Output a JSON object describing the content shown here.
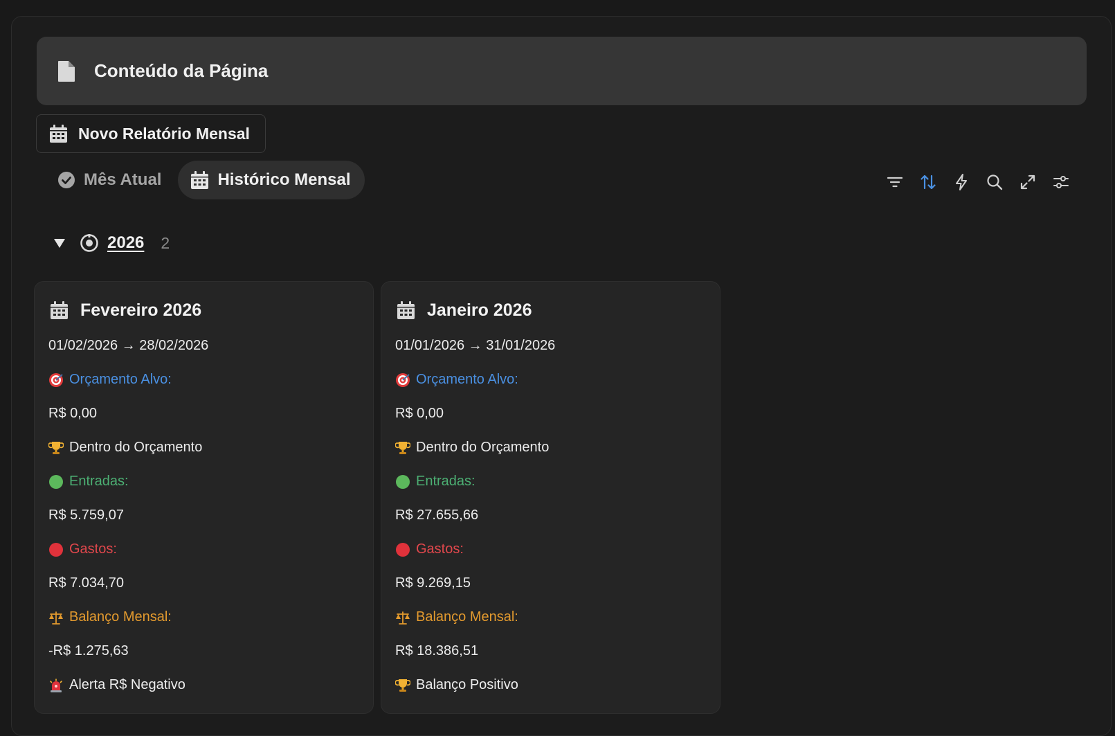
{
  "header": {
    "title": "Conteúdo da Página"
  },
  "new_report": {
    "label": "Novo Relatório Mensal"
  },
  "tabs": [
    {
      "label": "Mês Atual",
      "active": false
    },
    {
      "label": "Histórico Mensal",
      "active": true
    }
  ],
  "group": {
    "name": "2026",
    "count": "2"
  },
  "cards": [
    {
      "title": "Fevereiro 2026",
      "date_range": "01/02/2026 → 28/02/2026",
      "budget_label": "Orçamento Alvo:",
      "budget_value": "R$ 0,00",
      "budget_status": "Dentro do Orçamento",
      "income_label": "Entradas:",
      "income_value": "R$ 5.759,07",
      "expenses_label": "Gastos:",
      "expenses_value": "R$ 7.034,70",
      "balance_label": "Balanço Mensal:",
      "balance_value": "-R$ 1.275,63",
      "balance_status": "Alerta R$ Negativo",
      "balance_status_icon": "siren"
    },
    {
      "title": "Janeiro 2026",
      "date_range": "01/01/2026 → 31/01/2026",
      "budget_label": "Orçamento Alvo:",
      "budget_value": "R$ 0,00",
      "budget_status": "Dentro do Orçamento",
      "income_label": "Entradas:",
      "income_value": "R$ 27.655,66",
      "expenses_label": "Gastos:",
      "expenses_value": "R$ 9.269,15",
      "balance_label": "Balanço Mensal:",
      "balance_value": "R$ 18.386,51",
      "balance_status": "Balanço Positivo",
      "balance_status_icon": "trophy"
    }
  ],
  "colors": {
    "accent_blue": "#4a90e2",
    "income_green": "#4caf73",
    "expense_red": "#e0474c",
    "balance_orange": "#e39a2e"
  }
}
